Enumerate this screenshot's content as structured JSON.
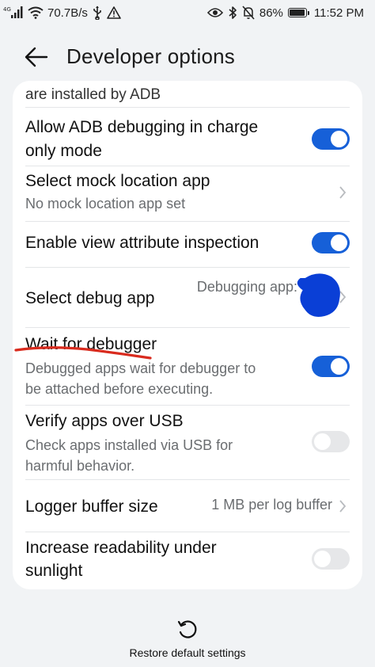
{
  "status_bar": {
    "network_type": "4G",
    "speed": "70.7B/s",
    "battery_percent": "86%",
    "battery_level": 0.86,
    "time": "11:52 PM",
    "icons": [
      "signal-icon",
      "wifi-icon",
      "usb-icon",
      "warning-icon",
      "eye-icon",
      "bluetooth-icon",
      "mute-bell-icon",
      "battery-icon"
    ]
  },
  "header": {
    "title": "Developer options"
  },
  "settings": {
    "cut_off_text": "are installed by ADB",
    "allow_adb": {
      "title_line1": "Allow ADB debugging in charge",
      "title_line2": "only mode",
      "enabled": true
    },
    "mock_location": {
      "title": "Select mock location app",
      "subtitle": "No mock location app set"
    },
    "view_attribute": {
      "title": "Enable view attribute inspection",
      "enabled": true
    },
    "debug_app": {
      "title": "Select debug app",
      "value": "Debugging app:"
    },
    "wait_debugger": {
      "title": "Wait for debugger",
      "subtitle_line1": "Debugged apps wait for debugger to",
      "subtitle_line2": "be attached before executing.",
      "enabled": true
    },
    "verify_usb": {
      "title": "Verify apps over USB",
      "subtitle_line1": "Check apps installed via USB for",
      "subtitle_line2": "harmful behavior.",
      "enabled": false
    },
    "logger_buffer": {
      "title": "Logger buffer size",
      "value": "1 MB per log buffer"
    },
    "readability": {
      "title_line1": "Increase readability under",
      "title_line2": "sunlight",
      "enabled": false
    }
  },
  "footer": {
    "restore_label": "Restore default settings"
  },
  "colors": {
    "accent": "#1660d8",
    "annotation_red": "#d92b1e",
    "annotation_blue": "#0a3fd6"
  }
}
